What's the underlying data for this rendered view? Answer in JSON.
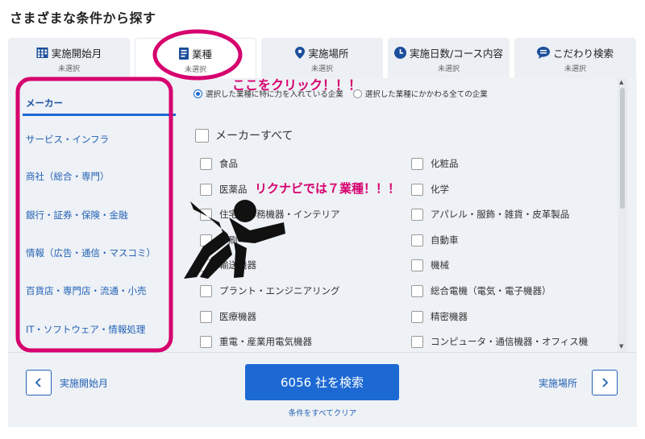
{
  "page": {
    "title": "さまざまな条件から探す"
  },
  "tabs": [
    {
      "label": "実施開始月",
      "sub": "未選択",
      "icon": "calendar-icon"
    },
    {
      "label": "業種",
      "sub": "未選択",
      "icon": "document-icon"
    },
    {
      "label": "実施場所",
      "sub": "未選択",
      "icon": "location-pin-icon"
    },
    {
      "label": "実施日数/コース内容",
      "sub": "未選択",
      "icon": "clock-icon"
    },
    {
      "label": "こだわり検索",
      "sub": "未選択",
      "icon": "chat-bubble-icon"
    }
  ],
  "sidebar": {
    "items": [
      {
        "label": "メーカー"
      },
      {
        "label": "サービス・インフラ"
      },
      {
        "label": "商社（総合・専門）"
      },
      {
        "label": "銀行・証券・保険・金融"
      },
      {
        "label": "情報（広告・通信・マスコミ）"
      },
      {
        "label": "百貨店・専門店・流通・小売"
      },
      {
        "label": "IT・ソフトウェア・情報処理"
      }
    ]
  },
  "options": {
    "radio_focus": "選択した業種に特に力を入れている企業",
    "radio_all": "選択した業種にかかわる全ての企業"
  },
  "industry": {
    "all_label": "メーカーすべて",
    "left": [
      "食品",
      "医薬品",
      "住宅・事務機器・インテリア",
      "印刷",
      "輸送機器",
      "プラント・エンジニアリング",
      "医療機器",
      "重電・産業用電気機器"
    ],
    "right": [
      "化粧品",
      "化学",
      "アパレル・服飾・雑貨・皮革製品",
      "自動車",
      "機械",
      "総合電機（電気・電子機器）",
      "精密機器",
      "コンピュータ・通信機器・オフィス機"
    ]
  },
  "footer": {
    "prev_label": "実施開始月",
    "next_label": "実施場所",
    "search_label": "6056 社を検索",
    "clear_label": "条件をすべてクリア"
  },
  "annotations": {
    "click_here": "ここをクリック！！！",
    "seven_industries": "リクナビでは７業種！！！"
  },
  "colors": {
    "accent": "#1c69d4",
    "link": "#2261b6",
    "annotation": "#d6006e",
    "panel": "#eef1f5"
  }
}
